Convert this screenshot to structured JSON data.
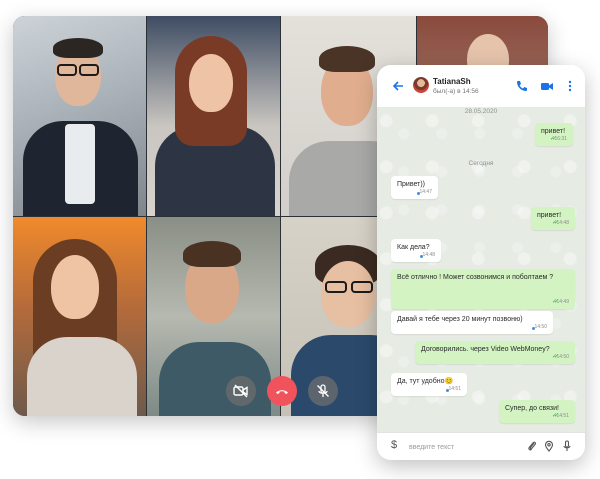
{
  "video_call": {
    "controls": [
      {
        "name": "camera-off",
        "icon": "video-off-icon"
      },
      {
        "name": "end-call",
        "icon": "phone-hangup-icon",
        "color": "#f0535c"
      },
      {
        "name": "mute",
        "icon": "mic-off-icon"
      }
    ]
  },
  "chat": {
    "contact_name": "TatianaSh",
    "contact_status": "был(-а) в 14:56",
    "header_icons": [
      "back-arrow-icon",
      "phone-icon",
      "video-icon",
      "more-vert-icon"
    ],
    "accent_color": "#1a73e8",
    "outgoing_bubble_color": "#d3f3c3",
    "date_separators": [
      "28.05.2020",
      "Сегодня"
    ],
    "messages": [
      {
        "direction": "out",
        "text": "привет!",
        "time": "16:31",
        "status": "read"
      },
      {
        "direction": "in",
        "text": "Привет))",
        "time": "14:47"
      },
      {
        "direction": "out",
        "text": "привет!",
        "time": "14:48",
        "status": "read"
      },
      {
        "direction": "in",
        "text": "Как дела?",
        "time": "14:48"
      },
      {
        "direction": "out",
        "text": "Всё отлично ! Может созвонимся и поболтаем ?",
        "time": "14:49",
        "status": "read"
      },
      {
        "direction": "in",
        "text": "Давай я тебе через 20 минут позвоню)",
        "time": "14:50"
      },
      {
        "direction": "out",
        "text": "Договорились. через Video WebMoney?",
        "time": "14:50",
        "status": "read"
      },
      {
        "direction": "in",
        "text": "Да, тут удобно😊",
        "time": "14:51"
      },
      {
        "direction": "out",
        "text": "Супер, до связи!",
        "time": "14:51",
        "status": "read"
      }
    ],
    "input_placeholder": "введите текст",
    "footer_icons": [
      "dollar-icon",
      "paperclip-icon",
      "location-icon",
      "mic-icon"
    ]
  }
}
